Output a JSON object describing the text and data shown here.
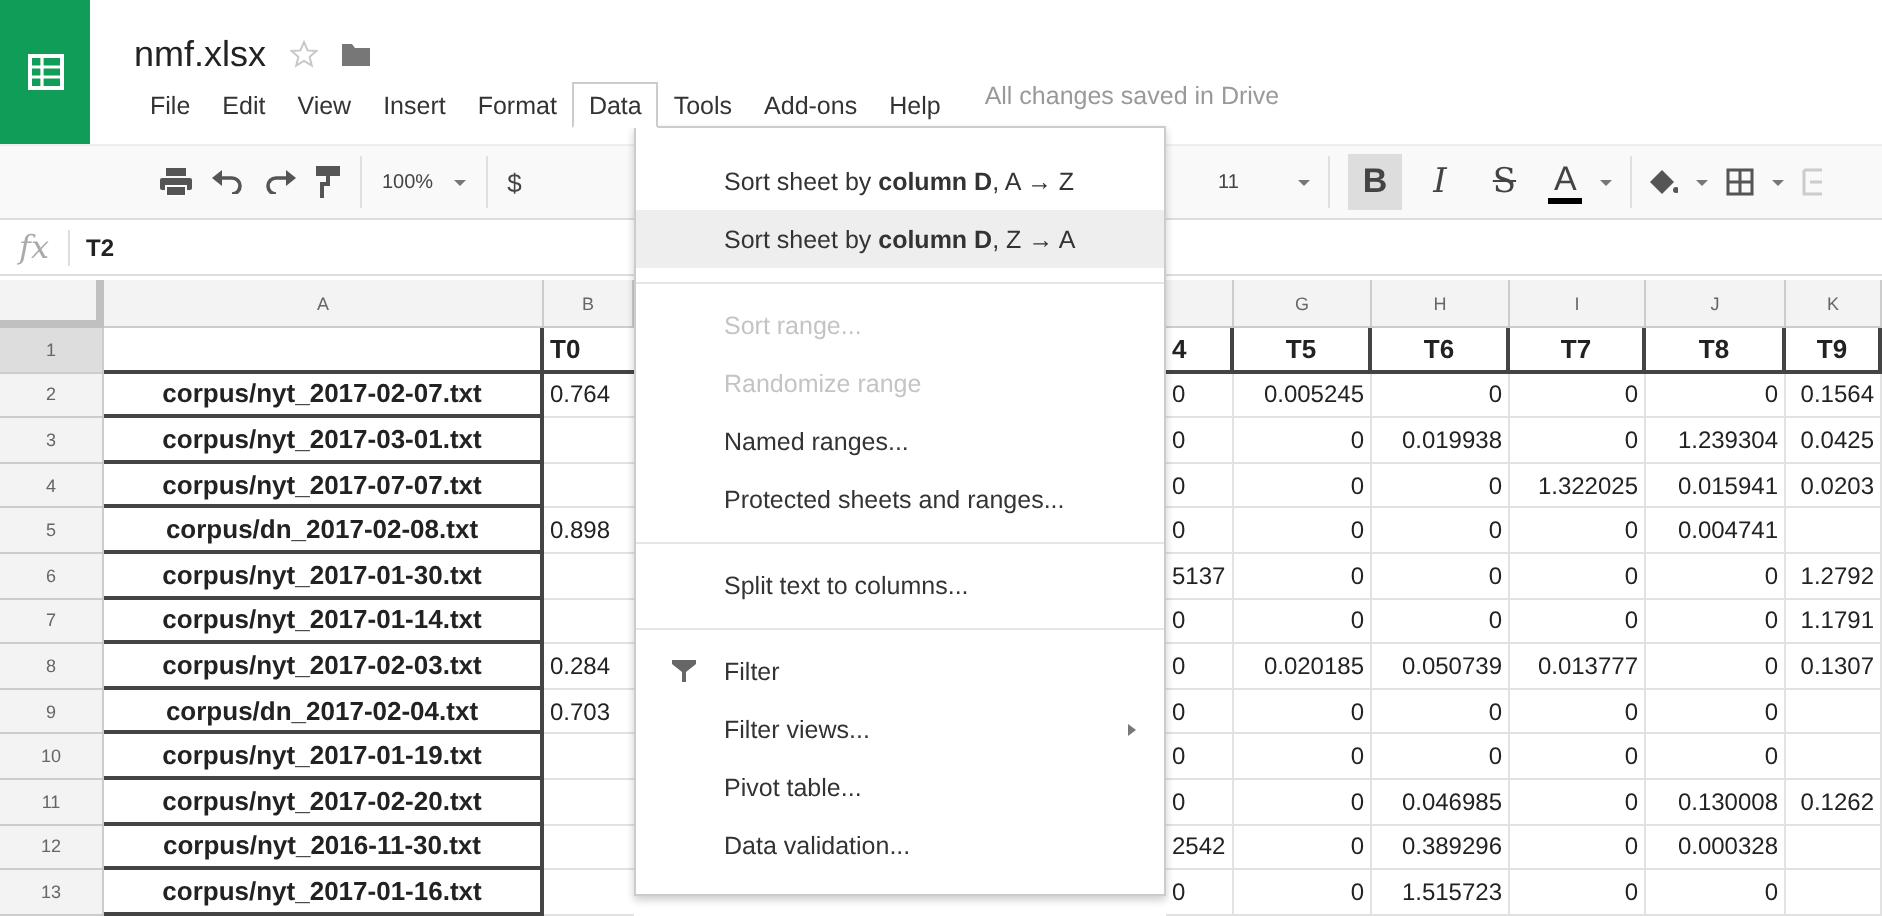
{
  "document": {
    "file_name": "nmf.xlsx",
    "starred": false
  },
  "menu_bar": [
    {
      "label": "File",
      "selected": false
    },
    {
      "label": "Edit",
      "selected": false
    },
    {
      "label": "View",
      "selected": false
    },
    {
      "label": "Insert",
      "selected": false
    },
    {
      "label": "Format",
      "selected": false
    },
    {
      "label": "Data",
      "selected": true
    },
    {
      "label": "Tools",
      "selected": false
    },
    {
      "label": "Add-ons",
      "selected": false
    },
    {
      "label": "Help",
      "selected": false
    }
  ],
  "save_status": "All changes saved in Drive",
  "toolbar": {
    "zoom": "100%",
    "number_format": "$",
    "font_size": "11",
    "format_buttons": [
      {
        "kind": "bold",
        "label": "B",
        "on": true
      },
      {
        "kind": "italic",
        "label": "I",
        "on": false
      },
      {
        "kind": "strike",
        "label": "S",
        "on": false
      },
      {
        "kind": "color",
        "label": "A",
        "on": false
      }
    ]
  },
  "formula_bar": {
    "label": "fx",
    "value": "T2"
  },
  "sheet": {
    "columns": [
      {
        "kind": "full",
        "letter": "A"
      },
      {
        "kind": "cut",
        "letter": "B"
      },
      {
        "kind": "covered"
      },
      {
        "kind": "cut"
      },
      {
        "kind": "full",
        "letter": "G"
      },
      {
        "kind": "full",
        "letter": "H"
      },
      {
        "kind": "full",
        "letter": "I"
      },
      {
        "kind": "full",
        "letter": "J"
      },
      {
        "kind": "full",
        "letter": "K"
      }
    ],
    "rows": [
      {
        "number": "1",
        "selected": true,
        "cells": [
          null,
          "T0",
          "4",
          "T5",
          "T6",
          "T7",
          "T8",
          "T9"
        ]
      },
      {
        "number": "2",
        "selected": false,
        "cells": [
          "corpus/nyt_2017-02-07.txt",
          "0.764",
          "0",
          "0.005245",
          "0",
          "0",
          "0",
          "0.1564"
        ]
      },
      {
        "number": "3",
        "selected": false,
        "cells": [
          "corpus/nyt_2017-03-01.txt",
          null,
          "0",
          "0",
          "0.019938",
          "0",
          "1.239304",
          "0.0425"
        ]
      },
      {
        "number": "4",
        "selected": false,
        "cells": [
          "corpus/nyt_2017-07-07.txt",
          null,
          "0",
          "0",
          "0",
          "1.322025",
          "0.015941",
          "0.0203"
        ]
      },
      {
        "number": "5",
        "selected": false,
        "cells": [
          "corpus/dn_2017-02-08.txt",
          "0.898",
          "0",
          "0",
          "0",
          "0",
          "0.004741",
          null
        ]
      },
      {
        "number": "6",
        "selected": false,
        "cells": [
          "corpus/nyt_2017-01-30.txt",
          null,
          "5137",
          "0",
          "0",
          "0",
          "0",
          "1.2792"
        ]
      },
      {
        "number": "7",
        "selected": false,
        "cells": [
          "corpus/nyt_2017-01-14.txt",
          null,
          "0",
          "0",
          "0",
          "0",
          "0",
          "1.1791"
        ]
      },
      {
        "number": "8",
        "selected": false,
        "cells": [
          "corpus/nyt_2017-02-03.txt",
          "0.284",
          "0",
          "0.020185",
          "0.050739",
          "0.013777",
          "0",
          "0.1307"
        ]
      },
      {
        "number": "9",
        "selected": false,
        "cells": [
          "corpus/dn_2017-02-04.txt",
          "0.703",
          "0",
          "0",
          "0",
          "0",
          "0",
          null
        ]
      },
      {
        "number": "10",
        "selected": false,
        "cells": [
          "corpus/nyt_2017-01-19.txt",
          null,
          "0",
          "0",
          "0",
          "0",
          "0",
          null
        ]
      },
      {
        "number": "11",
        "selected": false,
        "cells": [
          "corpus/nyt_2017-02-20.txt",
          null,
          "0",
          "0",
          "0.046985",
          "0",
          "0.130008",
          "0.1262"
        ]
      },
      {
        "number": "12",
        "selected": false,
        "cells": [
          "corpus/nyt_2016-11-30.txt",
          null,
          "2542",
          "0",
          "0.389296",
          "0",
          "0.000328",
          null
        ]
      },
      {
        "number": "13",
        "selected": false,
        "cells": [
          "corpus/nyt_2017-01-16.txt",
          null,
          "0",
          "0",
          "1.515723",
          "0",
          "0",
          null
        ]
      }
    ]
  },
  "data_menu": {
    "items": [
      {
        "kind": "item",
        "label": "Sort sheet by **column D**, A → Z",
        "disabled": false,
        "selected": false
      },
      {
        "kind": "item",
        "label": "Sort sheet by **column D**, Z → A",
        "disabled": false,
        "selected": true
      },
      {
        "kind": "separator"
      },
      {
        "kind": "item",
        "label": "Sort range...",
        "disabled": true,
        "selected": false
      },
      {
        "kind": "item",
        "label": "Randomize range",
        "disabled": true,
        "selected": false
      },
      {
        "kind": "item",
        "label": "Named ranges...",
        "disabled": false,
        "selected": false
      },
      {
        "kind": "item",
        "label": "Protected sheets and ranges...",
        "disabled": false,
        "selected": false
      },
      {
        "kind": "separator"
      },
      {
        "kind": "item",
        "label": "Split text to columns...",
        "disabled": false,
        "selected": false
      },
      {
        "kind": "separator"
      },
      {
        "kind": "filter",
        "label": "Filter",
        "disabled": false,
        "selected": false
      },
      {
        "kind": "submenu",
        "label": "Filter views...",
        "disabled": false,
        "selected": false
      },
      {
        "kind": "item",
        "label": "Pivot table...",
        "disabled": false,
        "selected": false
      },
      {
        "kind": "item",
        "label": "Data validation...",
        "disabled": false,
        "selected": false
      }
    ]
  }
}
